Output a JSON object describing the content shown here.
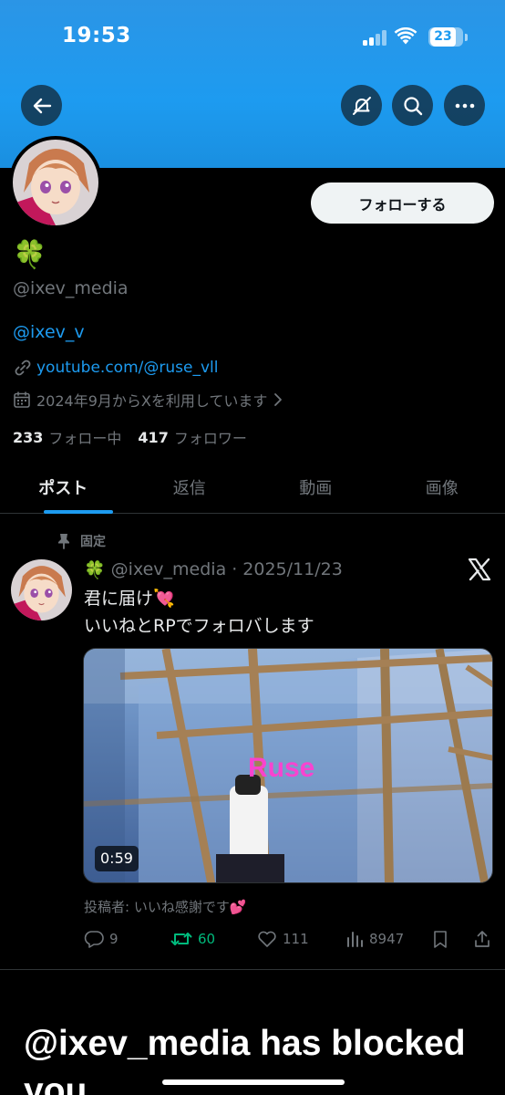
{
  "status_bar": {
    "time": "19:53",
    "battery": "23"
  },
  "header": {
    "back_icon": "arrow-left-icon",
    "muted_icon": "no-bell-icon",
    "search_icon": "search-icon",
    "more_icon": "more-dots-icon",
    "banner_color": "#1d9bf0"
  },
  "profile": {
    "follow_label": "フォローする",
    "display_name": "🍀",
    "handle": "@ixev_media",
    "bio_mention": "@ixev_v",
    "website": "youtube.com/@ruse_vll",
    "joined": "2024年9月からXを利用しています",
    "following_count": "233",
    "following_label": "フォロー中",
    "followers_count": "417",
    "followers_label": "フォロワー"
  },
  "tabs": [
    {
      "label": "ポスト",
      "active": true
    },
    {
      "label": "返信",
      "active": false
    },
    {
      "label": "動画",
      "active": false
    },
    {
      "label": "画像",
      "active": false
    }
  ],
  "pinned_tweet": {
    "pinned_label": "固定",
    "name": "🍀",
    "handle": "@ixev_media",
    "separator": "·",
    "date": "2025/11/23",
    "text_line1": "君に届け💘",
    "text_line2": "いいねとRPでフォロバします",
    "video_overlay_text": "Ruse",
    "video_duration": "0:59",
    "poster_note": "投稿者: いいね感謝です💕",
    "replies": "9",
    "reposts": "60",
    "likes": "111",
    "views": "8947",
    "repost_color": "#00ba7c"
  },
  "overlay": {
    "caption": "@ixev_media has blocked you"
  }
}
